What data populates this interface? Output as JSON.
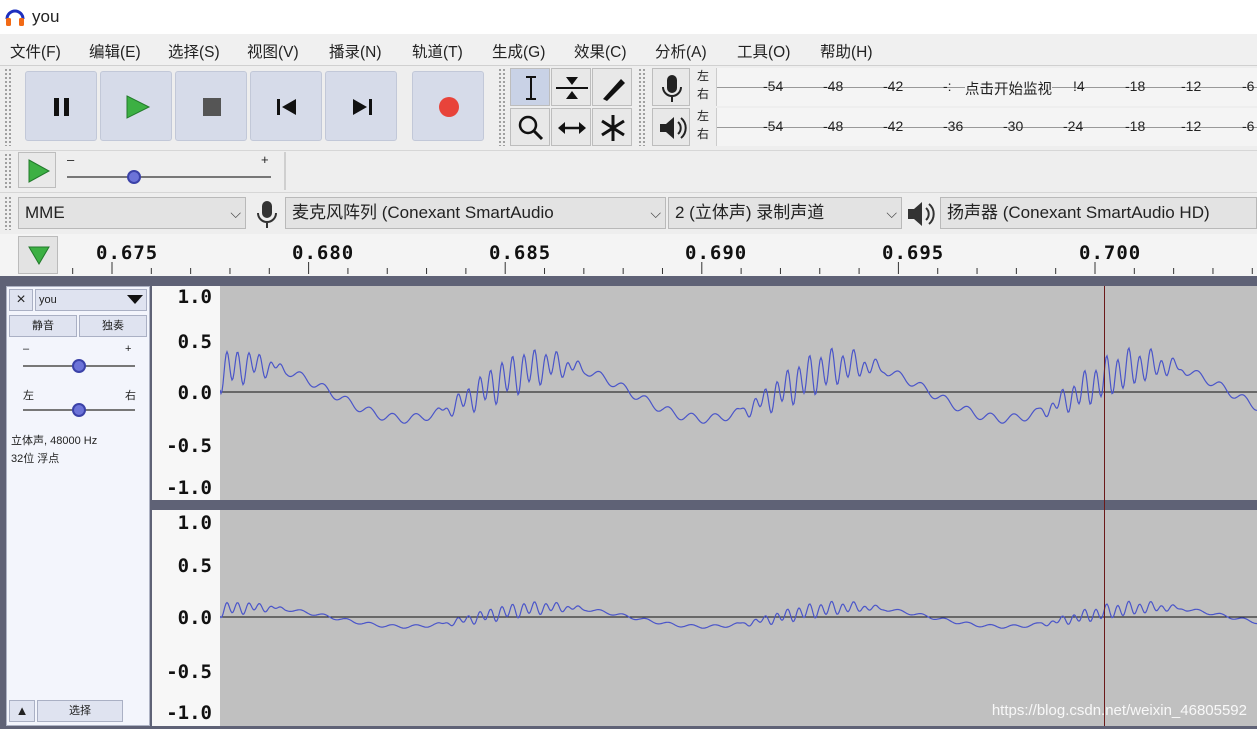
{
  "window": {
    "title": "you"
  },
  "menu": [
    "文件(F)",
    "编辑(E)",
    "选择(S)",
    "视图(V)",
    "播录(N)",
    "轨道(T)",
    "生成(G)",
    "效果(C)",
    "分析(A)",
    "工具(O)",
    "帮助(H)"
  ],
  "transport": [
    {
      "icon": "pause-icon",
      "label": "pause"
    },
    {
      "icon": "play-icon",
      "label": "play"
    },
    {
      "icon": "stop-icon",
      "label": "stop"
    },
    {
      "icon": "skip-to-start-icon",
      "label": "skip-to-start"
    },
    {
      "icon": "skip-to-end-icon",
      "label": "skip-to-end"
    },
    {
      "icon": "record-icon",
      "label": "record"
    }
  ],
  "tools": [
    "selection-tool-icon",
    "envelope-tool-icon",
    "draw-tool-icon",
    "zoom-tool-icon",
    "timeshift-tool-icon",
    "multi-tool-icon"
  ],
  "meters": {
    "record": {
      "left": "左",
      "right": "右",
      "ticks": [
        "-54",
        "-48",
        "-42",
        "-:",
        "点击开始监视",
        "!4",
        "-18",
        "-12",
        "-6"
      ]
    },
    "playback": {
      "left": "左",
      "right": "右",
      "ticks": [
        "-54",
        "-48",
        "-42",
        "-36",
        "-30",
        "-24",
        "-18",
        "-12",
        "-6"
      ]
    }
  },
  "play_at_speed": {
    "minus": "–",
    "plus": "+",
    "speed_fraction": 0.33
  },
  "devices": {
    "host": "MME",
    "input": "麦克风阵列 (Conexant SmartAudio",
    "channels": "2 (立体声) 录制声道",
    "output": "扬声器 (Conexant SmartAudio HD)"
  },
  "ruler": {
    "labels": [
      "0.675",
      "0.680",
      "0.685",
      "0.690",
      "0.695",
      "0.700"
    ]
  },
  "track": {
    "name": "you",
    "close": "×",
    "mute": "静音",
    "solo": "独奏",
    "gain_minus": "–",
    "gain_plus": "+",
    "pan_left": "左",
    "pan_right": "右",
    "gain_fraction": 0.5,
    "pan_fraction": 0.5,
    "info_line1": "立体声, 48000 Hz",
    "info_line2": "32位 浮点",
    "collapse": "▲",
    "select": "选择"
  },
  "vscale": [
    "1.0",
    "0.5",
    "0.0",
    "-0.5",
    "-1.0"
  ],
  "watermark": "https://blog.csdn.net/weixin_46805592",
  "colors": {
    "accent": "#4a55c9",
    "record": "#e8433a",
    "play": "#3cb043",
    "wave_bg": "#c0c0c0"
  }
}
